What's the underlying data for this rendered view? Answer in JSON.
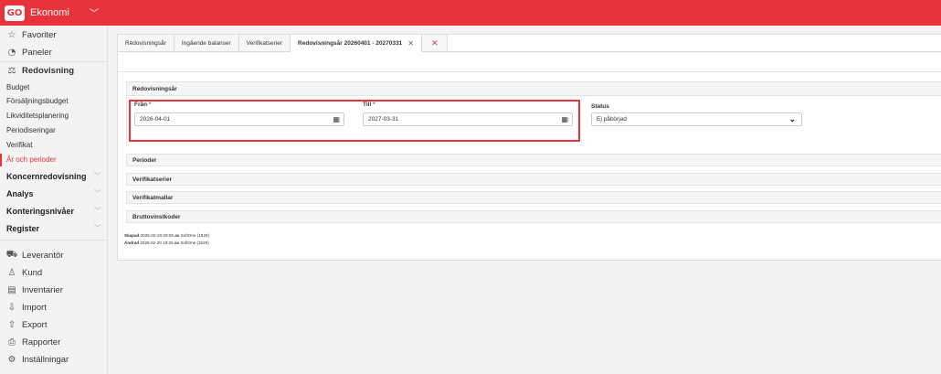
{
  "app": {
    "logo_text": "GO",
    "name": "Ekonomi",
    "menu_chevron": "chevron-down"
  },
  "sidebar": {
    "favorites": "Favoriter",
    "panels": "Paneler",
    "accounting": "Redovisning",
    "sub_items": [
      "Budget",
      "Försäljningsbudget",
      "Likviditetsplanering",
      "Periodiseringar",
      "Verifikat",
      "År och perioder"
    ],
    "active_sub_index": 5,
    "groups": [
      "Koncernredovisning",
      "Analys",
      "Konteringsnivåer",
      "Register"
    ],
    "bottom_items": [
      {
        "label": "Leverantör",
        "icon": "truck-icon"
      },
      {
        "label": "Kund",
        "icon": "person-icon"
      },
      {
        "label": "Inventarier",
        "icon": "inventory-icon"
      },
      {
        "label": "Import",
        "icon": "import-icon"
      },
      {
        "label": "Export",
        "icon": "export-icon"
      },
      {
        "label": "Rapporter",
        "icon": "printer-icon"
      },
      {
        "label": "Inställningar",
        "icon": "gear-icon"
      }
    ]
  },
  "tabs": [
    {
      "label": "Redovisningsår"
    },
    {
      "label": "Ingående balanser"
    },
    {
      "label": "Verifikatserier"
    },
    {
      "label": "Redovisningsår 20260401 - 20270331",
      "active": true
    }
  ],
  "form": {
    "section_title": "Redovisningsår",
    "from_label": "Från",
    "from_value": "2026-04-01",
    "to_label": "Till",
    "to_value": "2027-03-31",
    "required_mark": "*",
    "status_label": "Status",
    "status_value": "Ej påbörjad"
  },
  "sections": [
    "Perioder",
    "Verifikatserier",
    "Verifikatmallar",
    "Bruttovinstkoder"
  ],
  "meta": {
    "created_label": "Skapad",
    "created_value": "2025-02-20 09:06",
    "by": "av",
    "created_user": "SoftOne (1529)",
    "changed_label": "Ändrad",
    "changed_value": "2025-02-20 10:26",
    "changed_user": "SoftOne (1529)"
  },
  "colors": {
    "accent": "#e8333d"
  }
}
